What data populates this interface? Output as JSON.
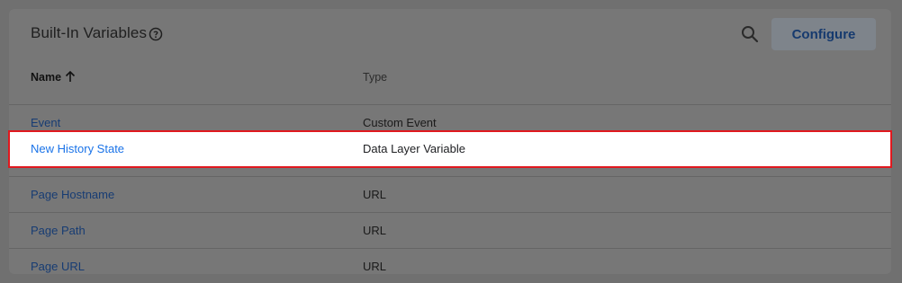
{
  "header": {
    "title": "Built-In Variables",
    "help_icon": "help-circle-icon",
    "search_icon": "search-icon",
    "configure_label": "Configure"
  },
  "table": {
    "columns": [
      "Name",
      "Type"
    ],
    "sort_icon": "arrow-up-icon",
    "rows": [
      {
        "name": "Event",
        "type": "Custom Event"
      },
      {
        "name": "New History State",
        "type": "Data Layer Variable"
      },
      {
        "name": "Page Hostname",
        "type": "URL"
      },
      {
        "name": "Page Path",
        "type": "URL"
      },
      {
        "name": "Page URL",
        "type": "URL"
      }
    ]
  },
  "colors": {
    "link": "#1a73e8",
    "highlight_border": "#e0191f",
    "overlay": "#707070"
  }
}
